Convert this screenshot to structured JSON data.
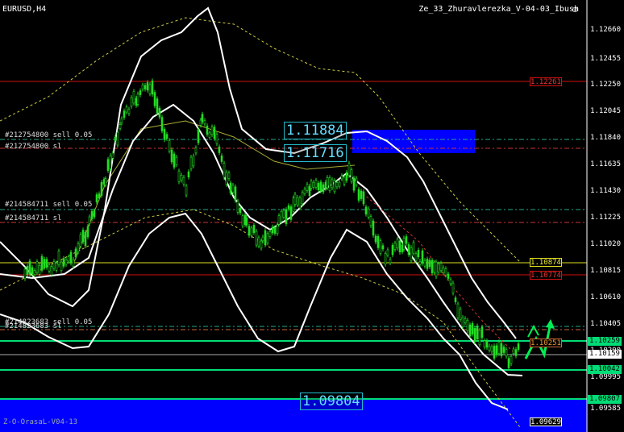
{
  "header": {
    "symbol": "EURUSD,H4",
    "indicator": "Ze_33_Zhuravlerezka_V-04-03_Ibush",
    "bottom_label": "Z-O-OrasaL-V04-13"
  },
  "orders": {
    "o1_sell": "#212754800 sell 0.05",
    "o1_sl": "#212754800 sl",
    "o2_sell": "#214584711 sell 0.05",
    "o2_sl": "#214584711 sl",
    "o3_sell": "#214823683 sell 0.05",
    "o3_sl": "#214823683 sl"
  },
  "big_prices": {
    "p1": "1.11884",
    "p2": "1.11716",
    "p3": "1.09804"
  },
  "price_tags": {
    "red_top": "1.12261",
    "yellow": "1.10874",
    "red_mid": "1.10774",
    "orange": "1.10251",
    "white": "1.09629"
  },
  "axis_boxes": {
    "green1": "1.10259",
    "white1": "1.10159",
    "green2": "1.10042",
    "green3": "1.09807"
  },
  "axis_ticks": [
    "1.12660",
    "1.12455",
    "1.12250",
    "1.12045",
    "1.11840",
    "1.11635",
    "1.11430",
    "1.11225",
    "1.11020",
    "1.10815",
    "1.10610",
    "1.10405",
    "1.10200",
    "1.09995",
    "1.09585"
  ],
  "colors": {
    "background": "#000000",
    "candles": "#22dd22",
    "bands": "#ffffff",
    "sell_zone": "#0000ff",
    "red_level": "#d01010",
    "yellow_level": "#e0e020",
    "green_level": "#00dd77",
    "signal_arrow": "#00ee55"
  }
}
